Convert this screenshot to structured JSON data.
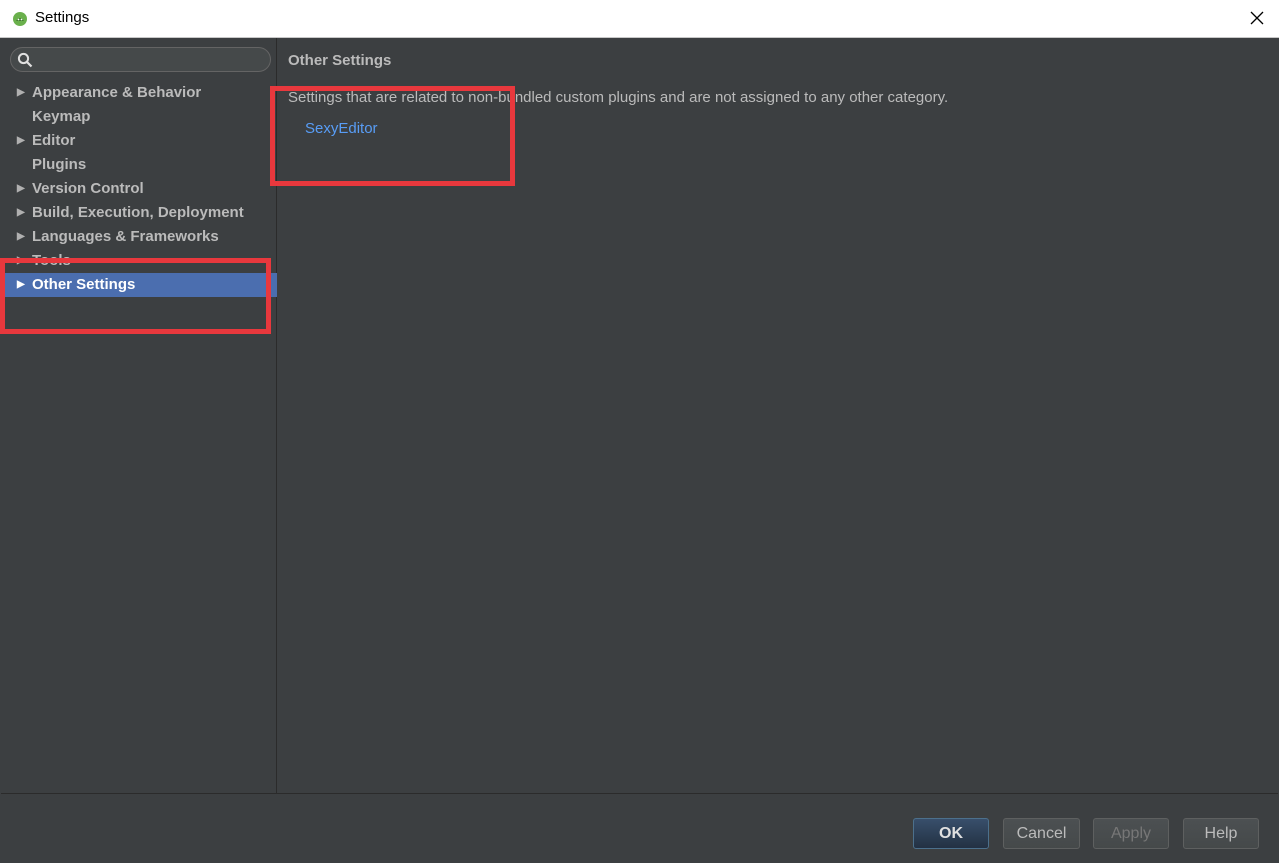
{
  "window": {
    "title": "Settings",
    "app_icon": "android-studio-icon",
    "close_icon": "close-icon"
  },
  "sidebar": {
    "search": {
      "value": "",
      "placeholder": ""
    },
    "items": [
      {
        "label": "Appearance & Behavior",
        "expandable": true,
        "selected": false
      },
      {
        "label": "Keymap",
        "expandable": false,
        "selected": false
      },
      {
        "label": "Editor",
        "expandable": true,
        "selected": false
      },
      {
        "label": "Plugins",
        "expandable": false,
        "selected": false
      },
      {
        "label": "Version Control",
        "expandable": true,
        "selected": false
      },
      {
        "label": "Build, Execution, Deployment",
        "expandable": true,
        "selected": false
      },
      {
        "label": "Languages & Frameworks",
        "expandable": true,
        "selected": false
      },
      {
        "label": "Tools",
        "expandable": true,
        "selected": false
      },
      {
        "label": "Other Settings",
        "expandable": true,
        "selected": true
      }
    ]
  },
  "content": {
    "title": "Other Settings",
    "description": "Settings that are related to non-bundled custom plugins and are not assigned to any other category.",
    "plugin_link": "SexyEditor"
  },
  "footer": {
    "ok": "OK",
    "cancel": "Cancel",
    "apply": "Apply",
    "help": "Help"
  },
  "colors": {
    "background": "#3c3f41",
    "selection": "#4b6eaf",
    "link": "#589df6",
    "annotation": "#e8383d"
  }
}
